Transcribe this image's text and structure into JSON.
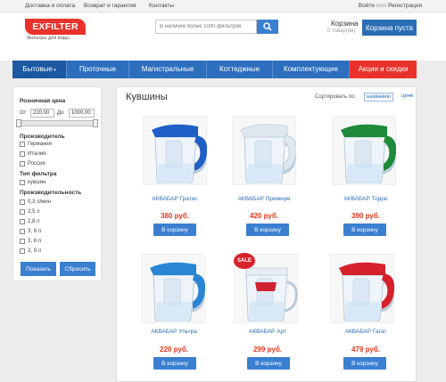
{
  "topbar": {
    "links": [
      "Доставка и оплата",
      "Возврат и гарантия",
      "Контакты"
    ],
    "login": "Войти",
    "or": "или",
    "register": "Регистрация"
  },
  "header": {
    "logo": "EXFILTER",
    "logo_sub": "Фильтры для воды",
    "search_placeholder": "В наличии более 1000 фильтров",
    "cart_title": "Корзина",
    "cart_count": "0 товар(ов)",
    "cart_button": "Корзина пуста"
  },
  "nav": [
    "Бытовые",
    "Проточные",
    "Магистральные",
    "Коттеджные",
    "Комплектующие",
    "Акции и скидки"
  ],
  "sidebar": {
    "price_title": "Розничная цена",
    "from_label": "От",
    "from_value": "220.00",
    "to_label": "До",
    "to_value": "1000.00",
    "price_range": [
      220,
      1000
    ],
    "manufacturer_title": "Производитель",
    "manufacturers": [
      "Германия",
      "Италия",
      "Россия"
    ],
    "filter_type_title": "Тип фильтра",
    "filter_types": [
      "кувшин"
    ],
    "capacity_title": "Производительность",
    "capacities": [
      "0,3 л/мин",
      "2,5 л",
      "2,8 л",
      "3, 8 л",
      "3, 8 л",
      "3, 9 л"
    ],
    "show_button": "Показать",
    "reset_button": "Сбросить"
  },
  "main": {
    "title": "Кувшины",
    "sort_label": "Сортировать по:",
    "sort_name": "названию",
    "sort_price": "цене",
    "add_to_cart": "В корзину",
    "sale_badge": "SALE",
    "products": [
      {
        "name": "АКВАБАР Гратис",
        "price": "380 руб.",
        "color": "#1f5fc6"
      },
      {
        "name": "АКВАБАР Премиум",
        "price": "420 руб.",
        "color": "#dfe8ef"
      },
      {
        "name": "АКВАБАР Торри",
        "price": "390 руб.",
        "color": "#1e8a3a"
      },
      {
        "name": "АКВАБАР Ультра",
        "price": "220 руб.",
        "color": "#2a86d4"
      },
      {
        "name": "АКВАБАР Арт",
        "price": "299 руб.",
        "color": "#cf2230"
      },
      {
        "name": "АКВАБАР Гагат",
        "price": "479 руб.",
        "color": "#d5212b"
      }
    ]
  }
}
